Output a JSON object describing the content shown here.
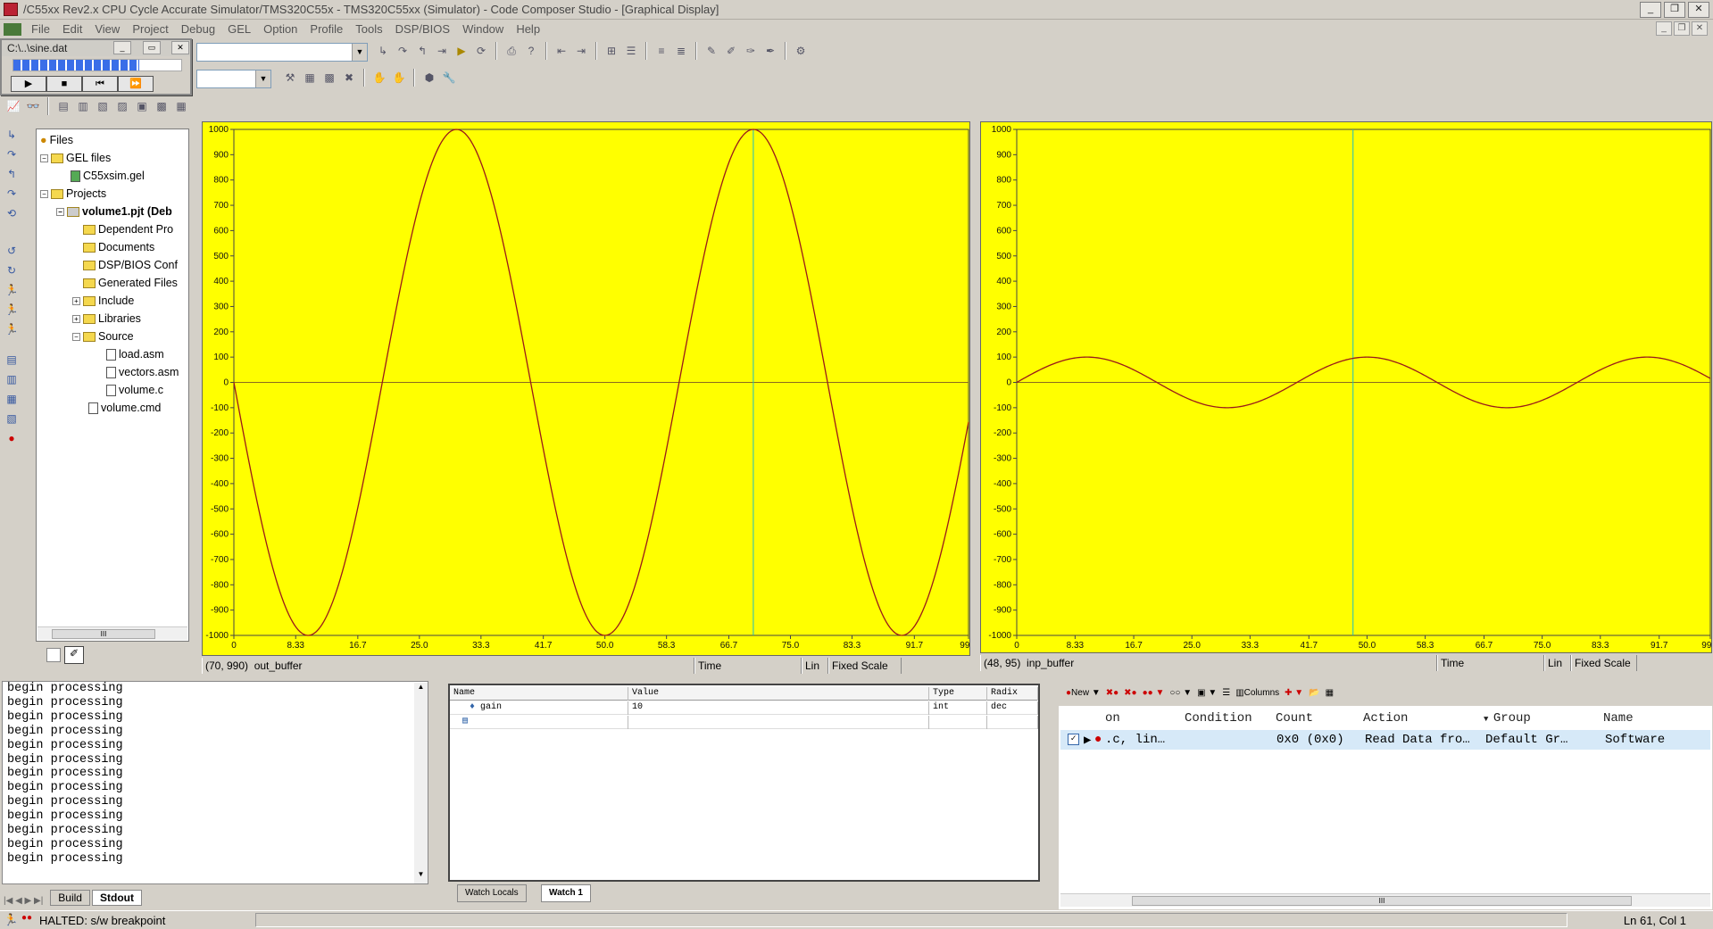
{
  "window": {
    "title": "/C55xx Rev2.x CPU Cycle Accurate Simulator/TMS320C55x - TMS320C55xx (Simulator) - Code Composer Studio - [Graphical Display]"
  },
  "menu": [
    "File",
    "Edit",
    "View",
    "Project",
    "Debug",
    "GEL",
    "Option",
    "Profile",
    "Tools",
    "DSP/BIOS",
    "Window",
    "Help"
  ],
  "file_io": {
    "title": "C:\\..\\sine.dat",
    "progress_pct": 75
  },
  "tree": {
    "root": "Files",
    "gel_folder": "GEL files",
    "gel_file": "C55xsim.gel",
    "projects": "Projects",
    "project": "volume1.pjt (Deb",
    "items": [
      "Dependent Pro",
      "Documents",
      "DSP/BIOS Conf",
      "Generated Files",
      "Include",
      "Libraries",
      "Source"
    ],
    "source_files": [
      "load.asm",
      "vectors.asm",
      "volume.c"
    ],
    "cmd_file": "volume.cmd",
    "hscroll_label": "III"
  },
  "graphs": [
    {
      "cursor": "(70, 990)",
      "name": "out_buffer",
      "axis_label": "Time",
      "scale": "Lin",
      "mode": "Fixed Scale"
    },
    {
      "cursor": "(48, 95)",
      "name": "inp_buffer",
      "axis_label": "Time",
      "scale": "Lin",
      "mode": "Fixed Scale"
    }
  ],
  "chart_data": [
    {
      "type": "line",
      "series": [
        {
          "name": "out_buffer",
          "values_desc": "sine amplitude 1000"
        }
      ],
      "x_ticks": [
        "0",
        "8.33",
        "16.7",
        "25.0",
        "33.3",
        "41.7",
        "50.0",
        "58.3",
        "66.7",
        "75.0",
        "83.3",
        "91.7",
        "99.0"
      ],
      "y_ticks": [
        "1000",
        "900",
        "800",
        "700",
        "600",
        "500",
        "400",
        "300",
        "200",
        "100",
        "0",
        "-100",
        "-200",
        "-300",
        "-400",
        "-500",
        "-600",
        "-700",
        "-800",
        "-900",
        "-1000"
      ],
      "ylim": [
        -1000,
        1000
      ],
      "xlim": [
        0,
        99
      ],
      "amplitude": 1000,
      "period": 40,
      "phase_deg": 180,
      "cursor_x": 70
    },
    {
      "type": "line",
      "series": [
        {
          "name": "inp_buffer",
          "values_desc": "sine amplitude 100"
        }
      ],
      "x_ticks": [
        "0",
        "8.33",
        "16.7",
        "25.0",
        "33.3",
        "41.7",
        "50.0",
        "58.3",
        "66.7",
        "75.0",
        "83.3",
        "91.7",
        "99.0"
      ],
      "y_ticks": [
        "1000",
        "900",
        "800",
        "700",
        "600",
        "500",
        "400",
        "300",
        "200",
        "100",
        "0",
        "-100",
        "-200",
        "-300",
        "-400",
        "-500",
        "-600",
        "-700",
        "-800",
        "-900",
        "-1000"
      ],
      "ylim": [
        -1000,
        1000
      ],
      "xlim": [
        0,
        99
      ],
      "amplitude": 100,
      "period": 40,
      "phase_deg": 0,
      "cursor_x": 48
    }
  ],
  "stdout": {
    "lines": [
      "begin processing",
      "begin processing",
      "begin processing",
      "begin processing",
      "begin processing",
      "begin processing",
      "begin processing",
      "begin processing",
      "begin processing",
      "begin processing",
      "begin processing",
      "begin processing",
      "begin processing"
    ],
    "tabs": [
      "Build",
      "Stdout"
    ]
  },
  "watch": {
    "headers": [
      "Name",
      "Value",
      "Type",
      "Radix"
    ],
    "rows": [
      {
        "name": "gain",
        "value": "10",
        "type": "int",
        "radix": "dec"
      }
    ],
    "tabs": [
      "Watch Locals",
      "Watch 1"
    ]
  },
  "breakpoints": {
    "toolbar": {
      "new": "New",
      "columns": "Columns"
    },
    "headers": [
      "on",
      "Condition",
      "Count",
      "Action",
      "Group",
      "Name"
    ],
    "row": {
      "location": ".c, lin…",
      "count": "0x0 (0x0)",
      "action": "Read Data fro…",
      "group": "Default Gr…",
      "name": "Software"
    },
    "hscroll_label": "III"
  },
  "status": {
    "text": "HALTED: s/w breakpoint",
    "position": "Ln 61, Col 1"
  }
}
